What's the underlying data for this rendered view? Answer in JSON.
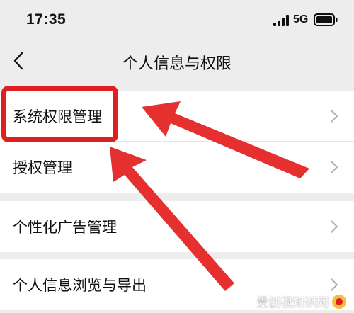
{
  "status_bar": {
    "time": "17:35",
    "network": "5G"
  },
  "nav": {
    "back_icon": "chevron-left-icon",
    "title": "个人信息与权限"
  },
  "menu": {
    "group1": [
      {
        "label": "系统权限管理"
      },
      {
        "label": "授权管理"
      }
    ],
    "group2": [
      {
        "label": "个性化广告管理"
      }
    ],
    "group3": [
      {
        "label": "个人信息浏览与导出"
      }
    ]
  },
  "annotation": {
    "highlight_color": "#e02020"
  },
  "watermark": {
    "text": "爱创根知识网"
  },
  "colors": {
    "background": "#ededed",
    "card": "#ffffff",
    "chevron": "#b2b2b2"
  }
}
